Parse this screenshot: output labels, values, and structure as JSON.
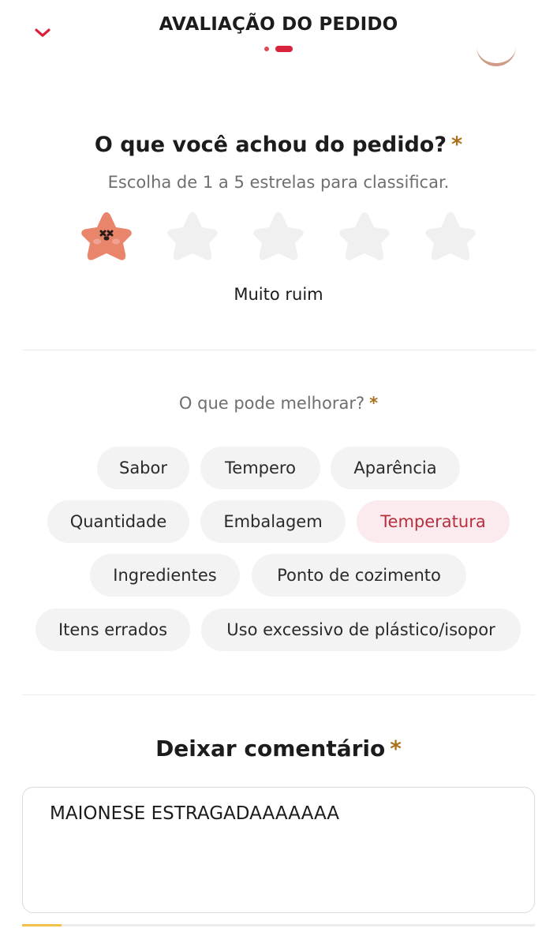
{
  "header": {
    "title": "AVALIAÇÃO DO PEDIDO"
  },
  "rating": {
    "question": "O que você achou do pedido?",
    "required_mark": "*",
    "subtitle": "Escolha de 1 a 5 estrelas para classificar.",
    "value": 1,
    "max": 5,
    "value_label": "Muito ruim",
    "selected_star_color": "#e8856a",
    "empty_star_color": "#f0f0f0"
  },
  "improve": {
    "question": "O que pode melhorar?",
    "required_mark": "*",
    "options": [
      {
        "label": "Sabor",
        "selected": false
      },
      {
        "label": "Tempero",
        "selected": false
      },
      {
        "label": "Aparência",
        "selected": false
      },
      {
        "label": "Quantidade",
        "selected": false
      },
      {
        "label": "Embalagem",
        "selected": false
      },
      {
        "label": "Temperatura",
        "selected": true
      },
      {
        "label": "Ingredientes",
        "selected": false
      },
      {
        "label": "Ponto de cozimento",
        "selected": false
      },
      {
        "label": "Itens errados",
        "selected": false
      },
      {
        "label": "Uso excessivo de plástico/isopor",
        "selected": false
      }
    ]
  },
  "comment": {
    "title": "Deixar comentário",
    "required_mark": "*",
    "value": "MAIONESE ESTRAGADAAAAAAA"
  },
  "colors": {
    "accent": "#d8233d",
    "required": "#a9711c",
    "chip_selected_bg": "#fcebee",
    "chip_selected_text": "#b7303f"
  }
}
